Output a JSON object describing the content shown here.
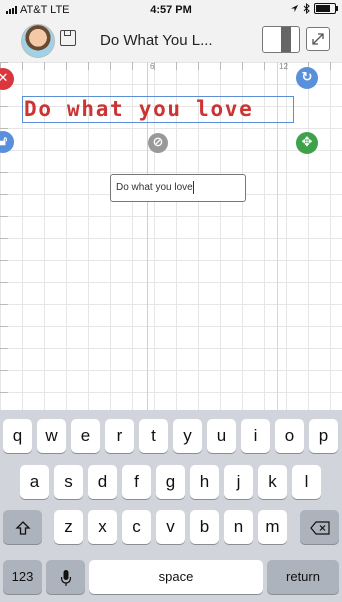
{
  "status_bar": {
    "carrier": "AT&T LTE",
    "time": "4:57 PM",
    "battery_level": 0.85
  },
  "toolbar": {
    "title": "Do What You L...",
    "icons": [
      "avatar",
      "save-icon",
      "split-view-icon",
      "expand-icon"
    ]
  },
  "canvas": {
    "ruler_labels": [
      "6",
      "12"
    ],
    "design_text": "Do what you love",
    "design_text_color": "#cc3333",
    "selection_color": "#5b8ed6",
    "handles": [
      "delete-icon",
      "rotate-icon",
      "unlock-icon",
      "resize-icon",
      "attach-icon"
    ],
    "handle_colors": {
      "delete": "#d9363e",
      "rotate": "#5a8fdb",
      "unlock": "#5a8fdb",
      "resize": "#3fa14a",
      "attach": "#999999"
    }
  },
  "text_input": {
    "value": "Do what you love"
  },
  "keyboard": {
    "row1": [
      "q",
      "w",
      "e",
      "r",
      "t",
      "y",
      "u",
      "i",
      "o",
      "p"
    ],
    "row2": [
      "a",
      "s",
      "d",
      "f",
      "g",
      "h",
      "j",
      "k",
      "l"
    ],
    "row3": [
      "z",
      "x",
      "c",
      "v",
      "b",
      "n",
      "m"
    ],
    "numbers_label": "123",
    "space_label": "space",
    "return_label": "return"
  }
}
